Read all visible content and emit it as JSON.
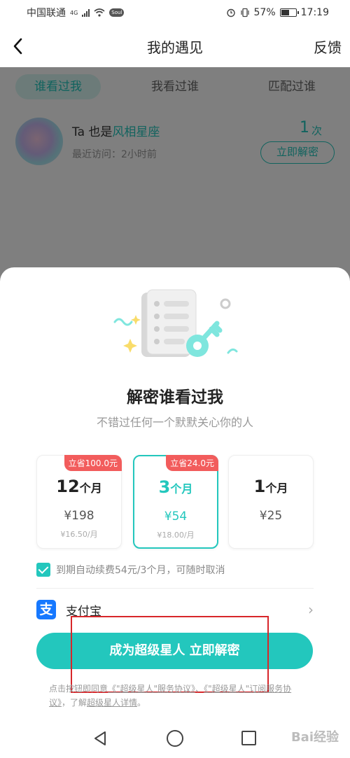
{
  "status_bar": {
    "carrier": "中国联通",
    "network": "4G",
    "app_badge": "Soul",
    "battery_percent": "57%",
    "battery_level": 0.57,
    "time": "17:19",
    "icons": [
      "signal-icon",
      "wifi-icon",
      "alarm-icon",
      "vibrate-icon",
      "battery-icon"
    ]
  },
  "nav": {
    "back_icon": "chevron-left-icon",
    "title": "我的遇见",
    "feedback": "反馈"
  },
  "tabs": [
    {
      "label": "谁看过我",
      "active": true
    },
    {
      "label": "我看过谁",
      "active": false
    },
    {
      "label": "匹配过谁",
      "active": false
    }
  ],
  "visitor": {
    "prefix": "Ta 也是",
    "highlight": "风相星座",
    "last_visit": "最近访问：2小时前",
    "count": "1",
    "count_unit": "次",
    "unlock_label": "立即解密"
  },
  "sheet": {
    "title": "解密谁看过我",
    "subtitle": "不错过任何一个默默关心你的人",
    "plans": [
      {
        "tag": "立省100.0元",
        "num": "12",
        "unit": "个月",
        "price": "¥198",
        "per_month": "¥16.50/月",
        "selected": false
      },
      {
        "tag": "立省24.0元",
        "num": "3",
        "unit": "个月",
        "price": "¥54",
        "per_month": "¥18.00/月",
        "selected": true
      },
      {
        "tag": "",
        "num": "1",
        "unit": "个月",
        "price": "¥25",
        "per_month": "",
        "selected": false
      }
    ],
    "renew_text": "到期自动续费54元/3个月，可随时取消",
    "renew_checked": true,
    "payment_method": "支付宝",
    "payment_icon_glyph": "支",
    "cta_label": "成为超级星人 立即解密",
    "terms": {
      "prefix": "点击按钮即同意",
      "link1": "《\"超级星人\"服务协议》",
      "sep": "、",
      "link2": "《\"超级星人\"订阅服务协议》",
      "mid": "，了解",
      "link3": "超级星人详情",
      "end": "。"
    }
  },
  "system_nav": {
    "icons": [
      "back-triangle-icon",
      "home-circle-icon",
      "recents-square-icon"
    ]
  },
  "watermark": "Bai经验",
  "colors": {
    "accent": "#23c7bd",
    "tag_red": "#f25c5c",
    "alipay_blue": "#1678ff",
    "highlight_border": "#d8262a"
  }
}
